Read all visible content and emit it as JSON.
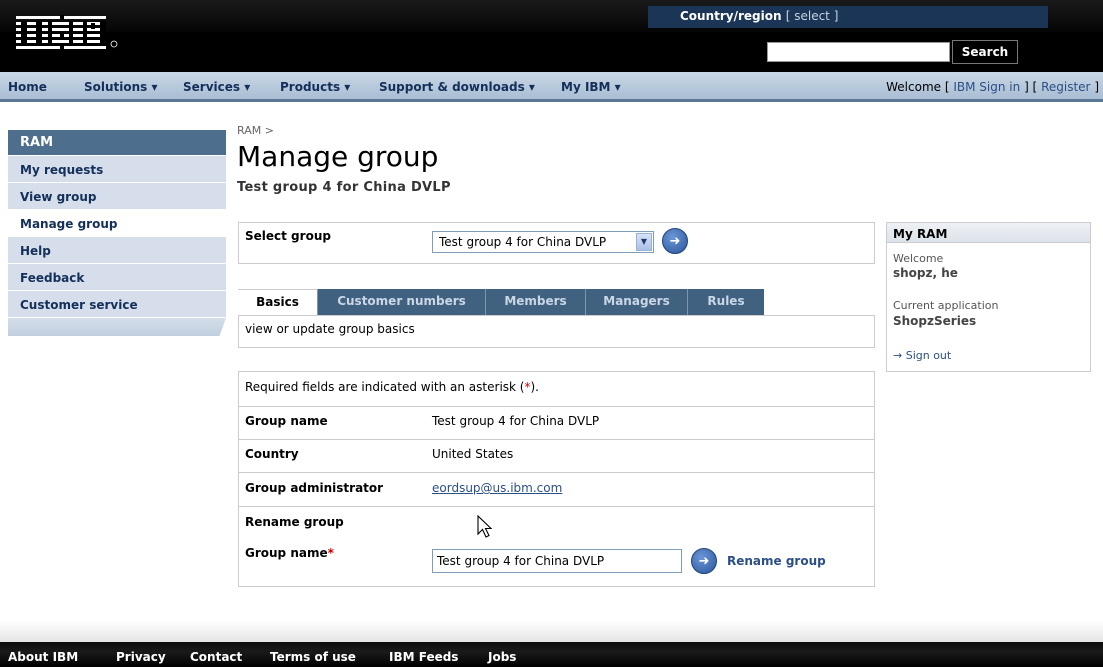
{
  "masthead": {
    "logo_text": "IBM",
    "country_label": "Country/region",
    "country_select": "[ select ]",
    "search_placeholder": "",
    "search_button": "Search"
  },
  "nav": {
    "items": [
      "Home",
      "Solutions ▾",
      "Services ▾",
      "Products ▾",
      "Support & downloads ▾",
      "My IBM ▾"
    ],
    "welcome_prefix": "Welcome [",
    "sign_in": "IBM Sign in",
    "mid": "] [",
    "register": "Register",
    "suffix": "]"
  },
  "sidebar": {
    "header": "RAM",
    "items": [
      "My requests",
      "View group",
      "Manage group",
      "Help",
      "Feedback",
      "Customer service"
    ],
    "active_index": 2
  },
  "main": {
    "breadcrumb": "RAM  >",
    "title": "Manage group",
    "subtitle": "Test group 4 for China DVLP",
    "select_group_label": "Select group",
    "select_group_value": "Test group 4 for China DVLP",
    "tabs": [
      "Basics",
      "Customer numbers",
      "Members",
      "Managers",
      "Rules"
    ],
    "active_tab": 0,
    "tab_description": "view or update group basics",
    "required_prefix": "Required fields are indicated with an asterisk (",
    "required_star": "*",
    "required_suffix": ").",
    "fields": {
      "group_name_label": "Group name",
      "group_name_value": "Test group 4 for China DVLP",
      "country_label": "Country",
      "country_value": "United States",
      "admin_label": "Group administrator",
      "admin_value": "eordsup@us.ibm.com"
    },
    "rename": {
      "section_label": "Rename group",
      "field_label": "Group name",
      "field_star": "*",
      "field_value": "Test group 4 for China DVLP",
      "button_label": "Rename group"
    }
  },
  "myram": {
    "header": "My RAM",
    "welcome_label": "Welcome",
    "user": "shopz, he",
    "app_label": "Current application",
    "app_value": "ShopzSeries",
    "signout": "→ Sign out"
  },
  "footer": {
    "items": [
      "About IBM",
      "Privacy",
      "Contact",
      "Terms of use",
      "IBM Feeds",
      "Jobs"
    ]
  },
  "colors": {
    "nav_bg": "#b7c8da",
    "sidebar_header": "#4e6e8e",
    "tab_bar": "#40617f",
    "link": "#2c4f86"
  }
}
